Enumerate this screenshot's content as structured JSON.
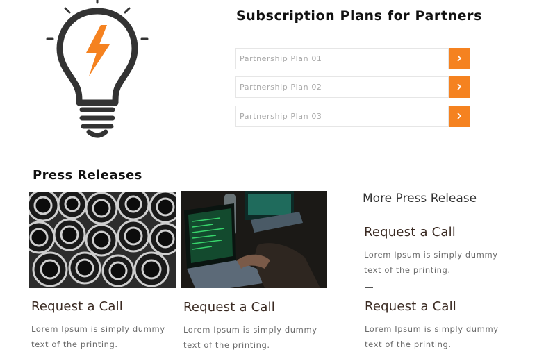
{
  "plans": {
    "title": "Subscription Plans for Partners",
    "items": [
      {
        "label": "Partnership Plan 01"
      },
      {
        "label": "Partnership Plan 02"
      },
      {
        "label": "Partnership Plan 03"
      }
    ]
  },
  "press": {
    "title": "Press Releases",
    "cards": [
      {
        "heading": "Request a Call",
        "text": "Lorem Ipsum is simply dummy text of the printing."
      },
      {
        "heading": "Request a Call",
        "text": "Lorem Ipsum is simply dummy text of the printing."
      }
    ]
  },
  "more": {
    "title": "More Press Release",
    "items": [
      {
        "heading": "Request a Call",
        "text": "Lorem Ipsum is simply dummy text of the printing."
      },
      {
        "heading": "Request a Call",
        "text": "Lorem Ipsum is simply dummy text of the printing."
      }
    ]
  },
  "colors": {
    "accent": "#f58220",
    "heading": "#3a2a22"
  },
  "icons": {
    "hero": "lightbulb-lightning-icon",
    "plan_button": "chevron-right-icon"
  }
}
